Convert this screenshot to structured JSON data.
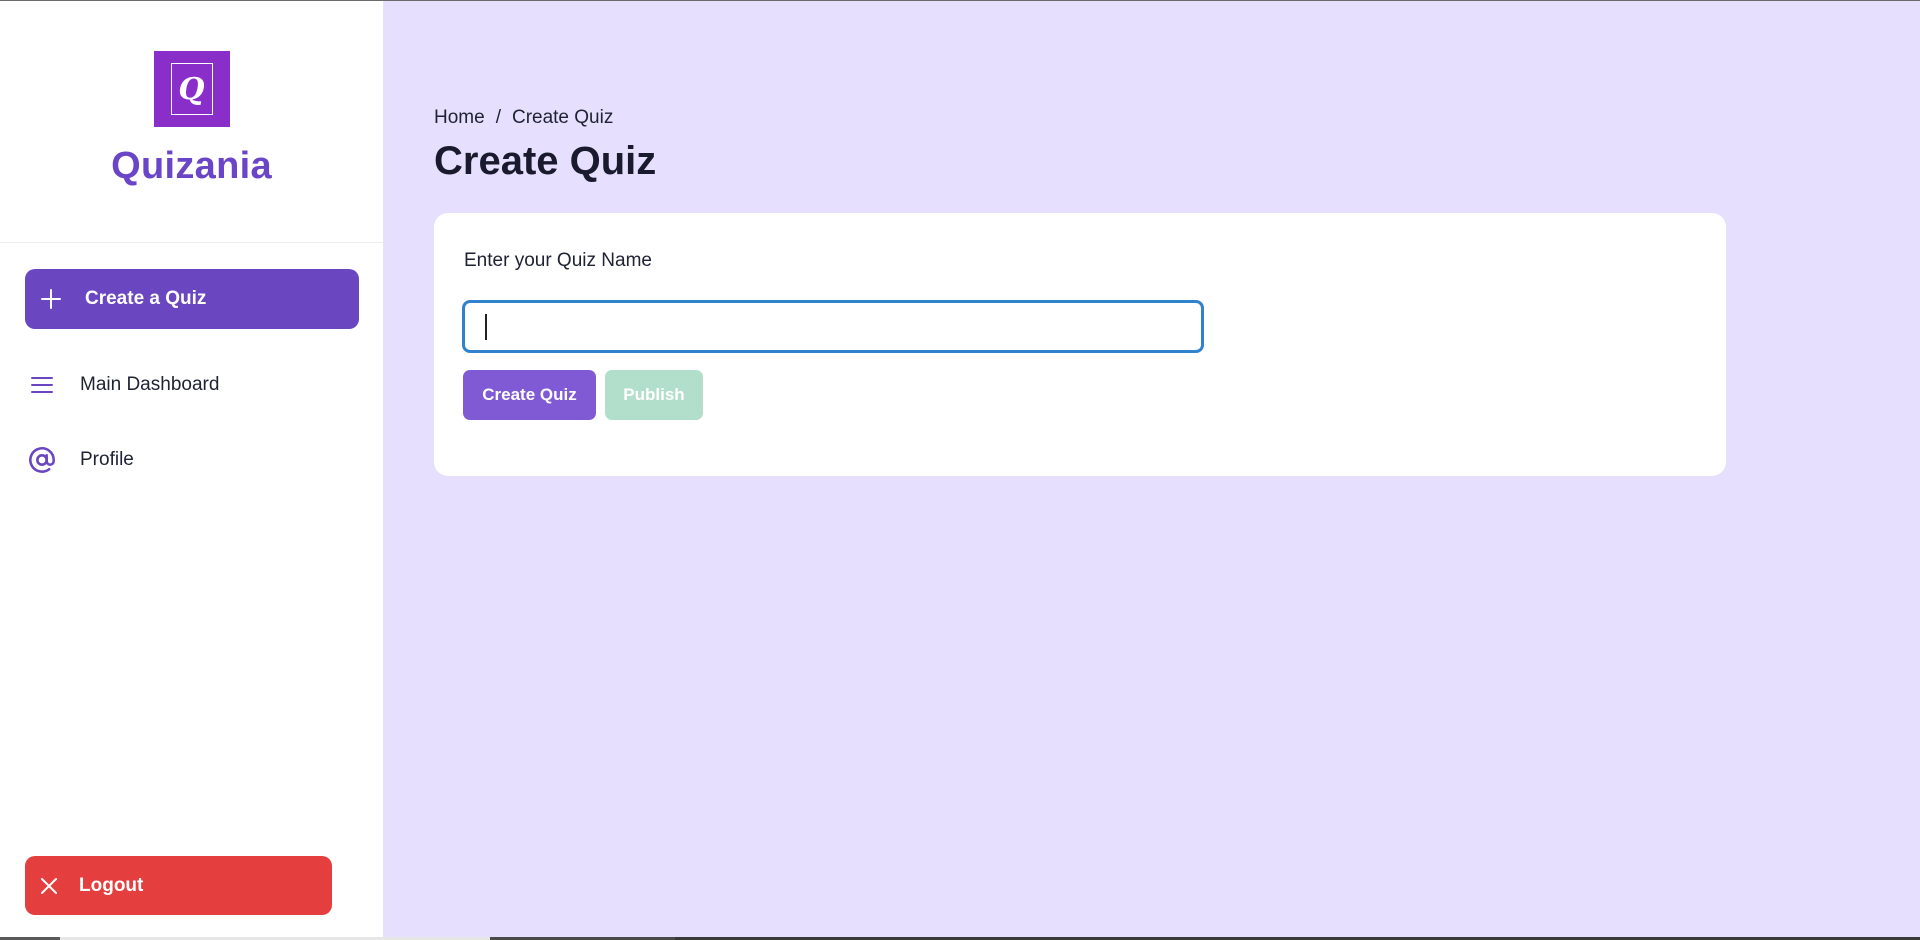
{
  "sidebar": {
    "brand": {
      "logo_letter": "Q",
      "name": "Quizania"
    },
    "create_button": {
      "label": "Create a Quiz",
      "icon": "plus-icon"
    },
    "items": [
      {
        "label": "Main Dashboard",
        "icon": "hamburger-menu-icon"
      },
      {
        "label": "Profile",
        "icon": "at-sign-icon"
      }
    ],
    "logout_button": {
      "label": "Logout",
      "icon": "close-icon"
    }
  },
  "main": {
    "breadcrumb": {
      "items": [
        "Home",
        "Create Quiz"
      ],
      "separator": "/"
    },
    "title": "Create Quiz",
    "form": {
      "label": "Enter your Quiz Name",
      "input_value": "",
      "create_button_label": "Create Quiz",
      "publish_button_label": "Publish",
      "publish_disabled": true
    }
  },
  "colors": {
    "accent": "#6b46c1",
    "brand_text": "#6a45c7",
    "logo_bg": "#8a2ec9",
    "main_bg": "#e6dffd",
    "danger": "#e53e3e",
    "publish_disabled": "#b2dfcb",
    "input_focus": "#3182ce"
  }
}
